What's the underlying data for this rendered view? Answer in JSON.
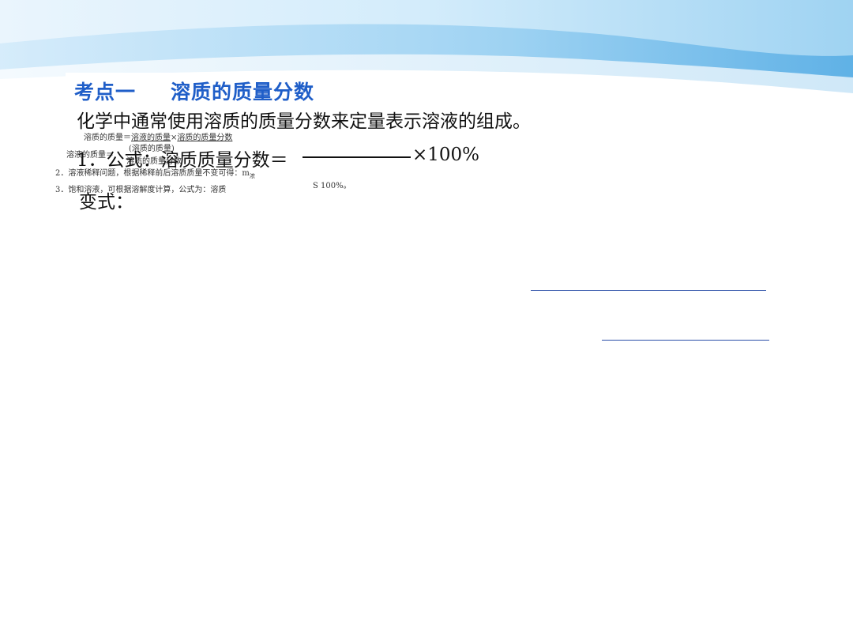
{
  "slide": {
    "title_part1": "考点一",
    "title_part2": "溶质的质量分数",
    "intro": "化学中通常使用溶质的质量分数来定量表示溶液的组成。",
    "formula_prefix": "1．公式：溶质质量分数＝",
    "formula_suffix": "×100%",
    "variant_label": "变式：",
    "small_notes": {
      "line1_a": "溶质的质量＝",
      "line1_b": "溶液的质量",
      "line1_c": "×",
      "line1_d": "溶质的质量分数",
      "frac_num": "(溶质的质量)",
      "line2_a": "溶液的质量＝",
      "line2_b": "溶质的质量分数",
      "line3": "2．溶液稀释问题，根据稀释前后溶质质量不变可得：m",
      "line3_sub": "浓",
      "line4": "3．饱和溶液，可根据溶解度计算，公式为：溶质",
      "line4_tail": "S  100%。"
    }
  },
  "colors": {
    "title": "#1f5ec8",
    "banner_light": "#e6f3fc",
    "banner_mid": "#a9d8f3",
    "banner_dark": "#5fb2e6",
    "answer_line": "#2b4fa8"
  }
}
